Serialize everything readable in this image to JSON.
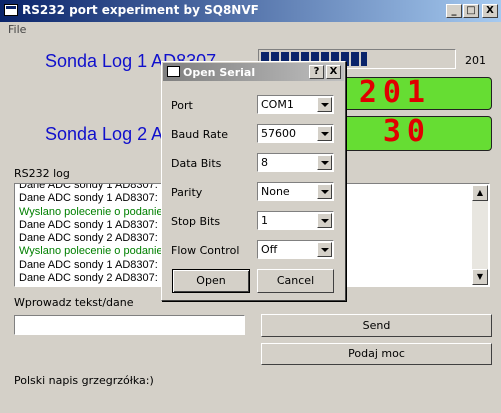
{
  "window": {
    "title": "RS232 port experiment by SQ8NVF",
    "min_label": "_",
    "max_label": "□",
    "close_label": "X"
  },
  "menu": {
    "file": "File"
  },
  "probe1": {
    "label": "Sonda Log 1 AD8307",
    "progress_value": "201",
    "progress_fraction": 0.55,
    "display": "201"
  },
  "probe2": {
    "label": "Sonda Log 2 AD8307",
    "display": "30"
  },
  "log": {
    "label": "RS232 log",
    "lines": [
      "Dane ADC sondy 1 AD8307: 201",
      "Dane ADC sondy 2 AD8307: 30",
      "Wyslano polecenie o podanie mocy",
      "Dane ADC sondy 1 AD8307: 201",
      "Dane ADC sondy 2 AD8307: 30",
      "Wyslano polecenie o podanie mocy",
      "Dane ADC sondy 1 AD8307: 201",
      "Dane ADC sondy 2 AD8307: 30"
    ],
    "partial_top": "Dane ADC sondy 1 AD8307:"
  },
  "input": {
    "label": "Wprowadz tekst/dane",
    "value": ""
  },
  "buttons": {
    "send": "Send",
    "power": "Podaj moc"
  },
  "footer": "Polski napis grzegrzółka:)",
  "dialog": {
    "title": "Open Serial",
    "help_label": "?",
    "close_label": "X",
    "fields": [
      {
        "label": "Port",
        "value": "COM1"
      },
      {
        "label": "Baud Rate",
        "value": "57600"
      },
      {
        "label": "Data Bits",
        "value": "8"
      },
      {
        "label": "Parity",
        "value": "None"
      },
      {
        "label": "Stop Bits",
        "value": "1"
      },
      {
        "label": "Flow Control",
        "value": "Off"
      }
    ],
    "open": "Open",
    "cancel": "Cancel"
  },
  "colors": {
    "probe_text": "#1010cc",
    "led_bg": "#66dd33",
    "led_digits": "#e00000",
    "log_green": "#008000"
  }
}
